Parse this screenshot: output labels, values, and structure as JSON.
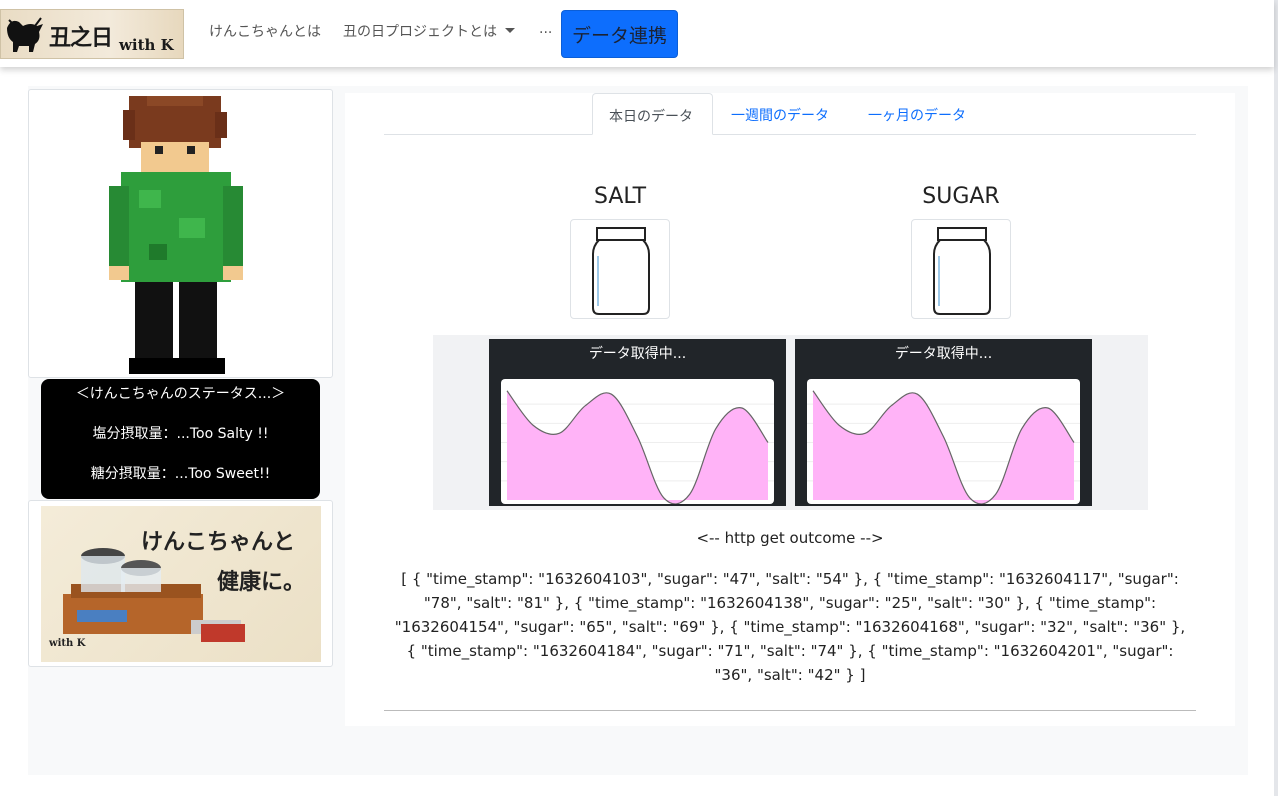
{
  "nav": {
    "logo_text": "丑之日",
    "logo_with": "with K",
    "items": [
      "けんこちゃんとは",
      "丑の日プロジェクトとは",
      "..."
    ],
    "button_label": "データ連携"
  },
  "status": {
    "title": "＜けんこちゃんのステータス...＞",
    "salt_line": "塩分摂取量：...Too Salty !!",
    "sugar_line": "糖分摂取量：...Too Sweet!!"
  },
  "promo": {
    "line1": "けんこちゃんと",
    "line2": "健康に。",
    "small": "with K"
  },
  "tabs": [
    "本日のデータ",
    "一週間のデータ",
    "一ヶ月のデータ"
  ],
  "jars": {
    "salt_title": "SALT",
    "sugar_title": "SUGAR"
  },
  "charts": {
    "salt_label": "データ取得中...",
    "sugar_label": "データ取得中..."
  },
  "chart_data": [
    {
      "type": "area",
      "title": "データ取得中...",
      "x": [
        0,
        1,
        2,
        3,
        4,
        5,
        6,
        7,
        8,
        9,
        10
      ],
      "values": [
        0.95,
        0.65,
        0.58,
        0.82,
        0.92,
        0.55,
        0.02,
        0.05,
        0.62,
        0.8,
        0.5
      ],
      "fill": "#ffb3f7",
      "stroke": "#666666"
    },
    {
      "type": "area",
      "title": "データ取得中...",
      "x": [
        0,
        1,
        2,
        3,
        4,
        5,
        6,
        7,
        8,
        9,
        10
      ],
      "values": [
        0.95,
        0.65,
        0.58,
        0.82,
        0.92,
        0.55,
        0.02,
        0.05,
        0.62,
        0.8,
        0.5
      ],
      "fill": "#ffb3f7",
      "stroke": "#666666"
    }
  ],
  "http": {
    "title": "<-- http get outcome -->",
    "body": "[ { \"time_stamp\": \"1632604103\", \"sugar\": \"47\", \"salt\": \"54\" }, { \"time_stamp\": \"1632604117\", \"sugar\": \"78\", \"salt\": \"81\" }, { \"time_stamp\": \"1632604138\", \"sugar\": \"25\", \"salt\": \"30\" }, { \"time_stamp\": \"1632604154\", \"sugar\": \"65\", \"salt\": \"69\" }, { \"time_stamp\": \"1632604168\", \"sugar\": \"32\", \"salt\": \"36\" }, { \"time_stamp\": \"1632604184\", \"sugar\": \"71\", \"salt\": \"74\" }, { \"time_stamp\": \"1632604201\", \"sugar\": \"36\", \"salt\": \"42\" } ]"
  }
}
